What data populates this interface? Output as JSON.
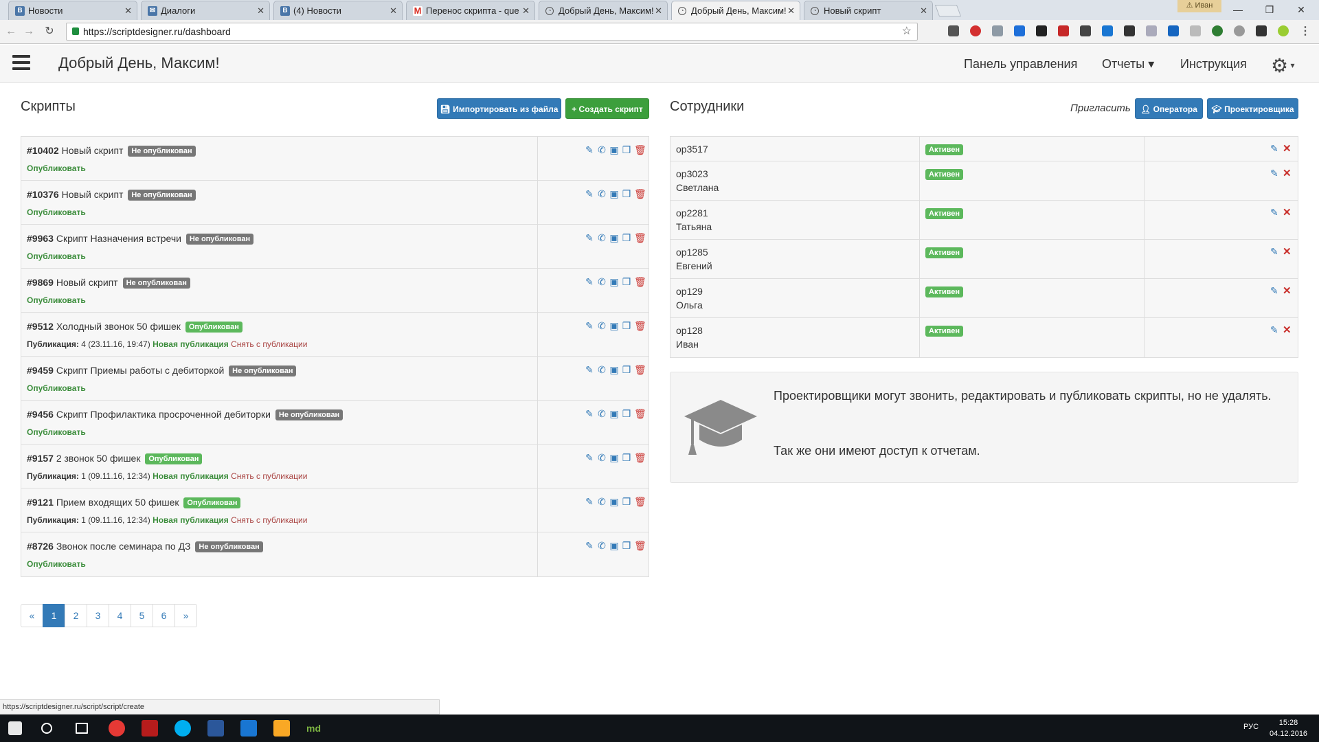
{
  "browser": {
    "tabs": [
      {
        "label": "Новости",
        "favicon": "vk-icon"
      },
      {
        "label": "Диалоги",
        "favicon": "messages-icon"
      },
      {
        "label": "(4) Новости",
        "favicon": "vk-icon"
      },
      {
        "label": "Перенос скрипта - que",
        "favicon": "gmail-icon"
      },
      {
        "label": "Добрый День, Максим!",
        "favicon": "scriptdesigner-icon"
      },
      {
        "label": "Добрый День, Максим!",
        "favicon": "scriptdesigner-icon"
      },
      {
        "label": "Новый скрипт",
        "favicon": "scriptdesigner-icon"
      }
    ],
    "active_tab_index": 5,
    "profile_name": "Иван",
    "url": "https://scriptdesigner.ru/dashboard",
    "status_url": "https://scriptdesigner.ru/script/script/create"
  },
  "nav": {
    "greeting": "Добрый День, Максим!",
    "links": [
      "Панель управления",
      "Отчеты ▾",
      "Инструкция"
    ]
  },
  "scripts": {
    "title": "Скрипты",
    "import_label": "Импортировать из файла",
    "create_label": "+ Создать скрипт",
    "rows": [
      {
        "id": "#10402",
        "name": "Новый скрипт",
        "status": "Не опубликован",
        "published": false,
        "publish_link": "Опубликовать"
      },
      {
        "id": "#10376",
        "name": "Новый скрипт",
        "status": "Не опубликован",
        "published": false,
        "publish_link": "Опубликовать"
      },
      {
        "id": "#9963",
        "name": "Скрипт Назначения встречи",
        "status": "Не опубликован",
        "published": false,
        "publish_link": "Опубликовать"
      },
      {
        "id": "#9869",
        "name": "Новый скрипт",
        "status": "Не опубликован",
        "published": false,
        "publish_link": "Опубликовать"
      },
      {
        "id": "#9512",
        "name": "Холодный звонок 50 фишек",
        "status": "Опубликован",
        "published": true,
        "pub_label": "Публикация:",
        "pub_value": "4 (23.11.16, 19:47)",
        "new_pub": "Новая публикация",
        "unpublish": "Снять с публикации"
      },
      {
        "id": "#9459",
        "name": "Скрипт Приемы работы с дебиторкой",
        "status": "Не опубликован",
        "published": false,
        "publish_link": "Опубликовать"
      },
      {
        "id": "#9456",
        "name": "Скрипт Профилактика просроченной дебиторки",
        "status": "Не опубликован",
        "published": false,
        "publish_link": "Опубликовать"
      },
      {
        "id": "#9157",
        "name": "2 звонок 50 фишек",
        "status": "Опубликован",
        "published": true,
        "pub_label": "Публикация:",
        "pub_value": "1 (09.11.16, 12:34)",
        "new_pub": "Новая публикация",
        "unpublish": "Снять с публикации"
      },
      {
        "id": "#9121",
        "name": "Прием входящих 50 фишек",
        "status": "Опубликован",
        "published": true,
        "pub_label": "Публикация:",
        "pub_value": "1 (09.11.16, 12:34)",
        "new_pub": "Новая публикация",
        "unpublish": "Снять с публикации"
      },
      {
        "id": "#8726",
        "name": "Звонок после семинара по ДЗ",
        "status": "Не опубликован",
        "published": false,
        "publish_link": "Опубликовать"
      }
    ]
  },
  "pagination": {
    "prev": "«",
    "pages": [
      "1",
      "2",
      "3",
      "4",
      "5",
      "6"
    ],
    "active": "1",
    "next": "»"
  },
  "employees": {
    "title": "Сотрудники",
    "invite_label": "Пригласить",
    "operator_btn": "Оператора",
    "designer_btn": "Проектировщика",
    "rows": [
      {
        "login": "op3517",
        "name": "",
        "status": "Активен"
      },
      {
        "login": "op3023",
        "name": "Светлана",
        "status": "Активен"
      },
      {
        "login": "op2281",
        "name": "Татьяна",
        "status": "Активен"
      },
      {
        "login": "op1285",
        "name": "Евгений",
        "status": "Активен"
      },
      {
        "login": "op129",
        "name": "Ольга",
        "status": "Активен"
      },
      {
        "login": "op128",
        "name": "Иван",
        "status": "Активен"
      }
    ]
  },
  "info": {
    "line1": "Проектировщики могут звонить, редактировать и публиковать скрипты, но не удалять.",
    "line2": "Так же они имеют доступ к отчетам.",
    "icon": "graduation-cap-icon"
  },
  "taskbar": {
    "lang": "РУС",
    "time": "15:28",
    "date": "04.12.2016"
  },
  "colors": {
    "primary": "#337ab7",
    "success": "#3c9f3c",
    "danger": "#c9302c",
    "badge_gray": "#777777",
    "badge_green": "#5cb85c"
  }
}
